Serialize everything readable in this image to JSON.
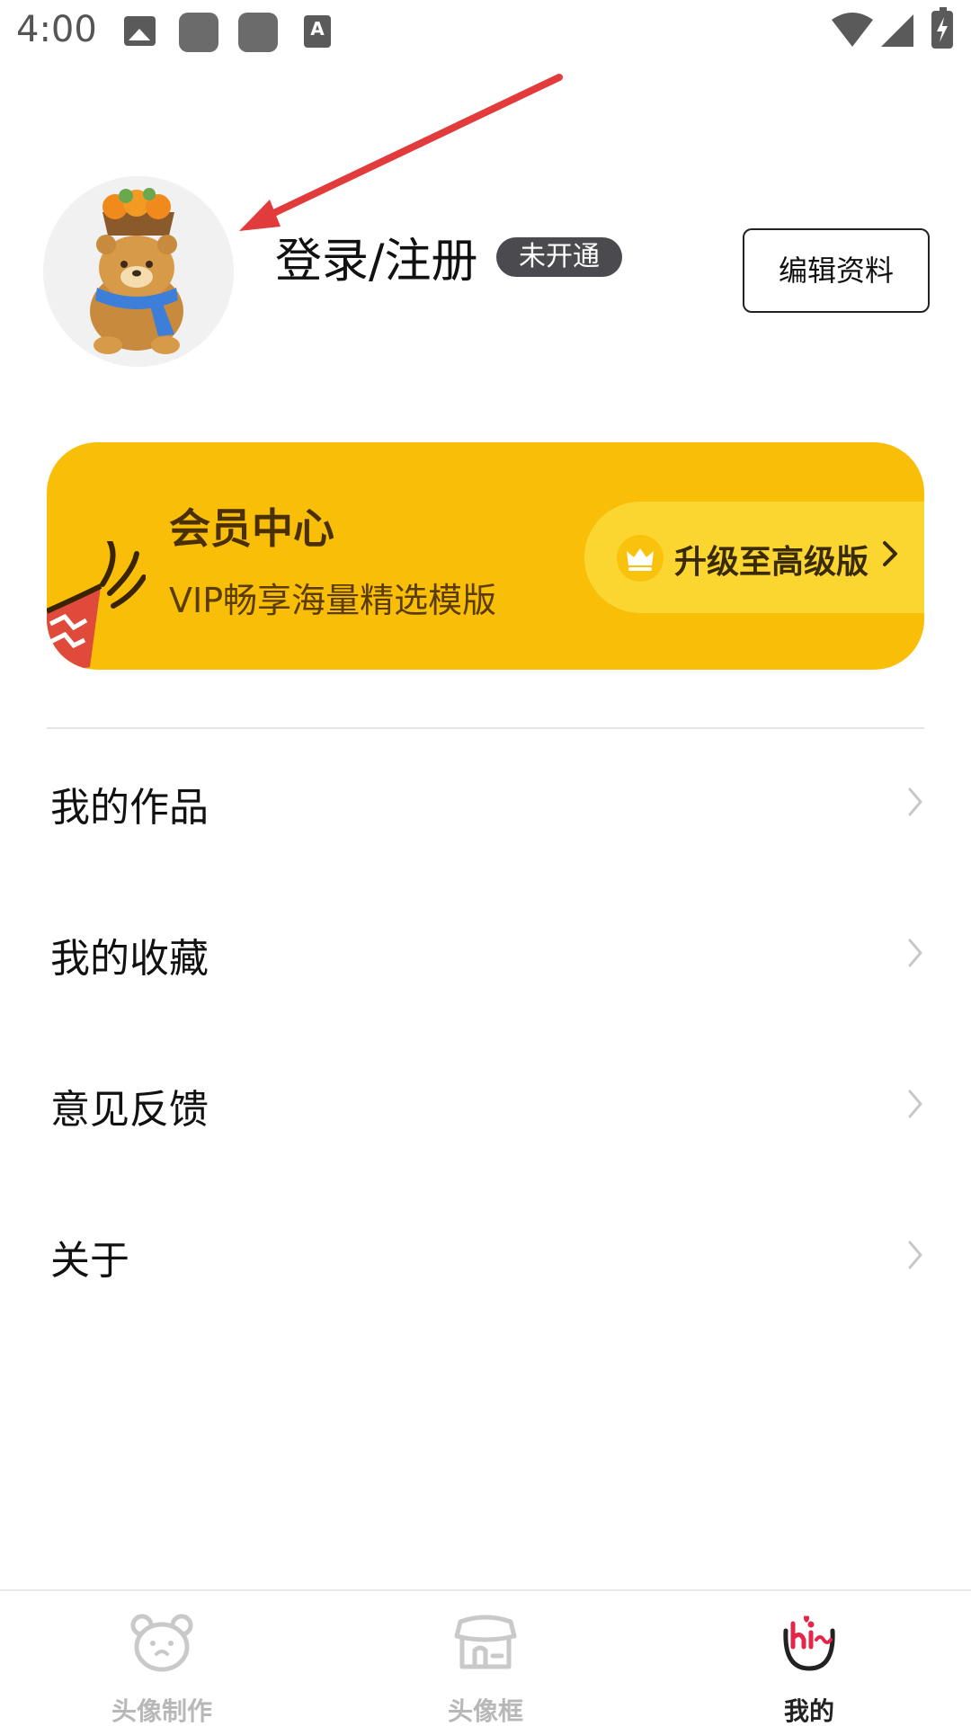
{
  "status_bar": {
    "time": "4:00",
    "icons": [
      "image-icon",
      "app-icon",
      "app-icon",
      "keyboard-a-icon",
      "wifi-icon",
      "signal-icon",
      "battery-charging-icon"
    ]
  },
  "profile": {
    "login_label": "登录/注册",
    "vip_status_badge": "未开通",
    "edit_profile_button": "编辑资料",
    "avatar": "bear-avatar-icon"
  },
  "vip_card": {
    "title": "会员中心",
    "subtitle": "VIP畅享海量精选模版",
    "upgrade_label": "升级至高级版",
    "icons": [
      "party-popper-icon",
      "crown-icon",
      "chevron-right-icon"
    ],
    "colors": {
      "card": "#f9be07",
      "pill": "#fcd630"
    }
  },
  "menu": {
    "items": [
      {
        "label": "我的作品"
      },
      {
        "label": "我的收藏"
      },
      {
        "label": "意见反馈"
      },
      {
        "label": "关于"
      }
    ]
  },
  "bottom_nav": {
    "items": [
      {
        "label": "头像制作",
        "icon": "bear-face-icon",
        "active": false
      },
      {
        "label": "头像框",
        "icon": "store-icon",
        "active": false
      },
      {
        "label": "我的",
        "icon": "hi-mine-icon",
        "active": true
      }
    ]
  }
}
